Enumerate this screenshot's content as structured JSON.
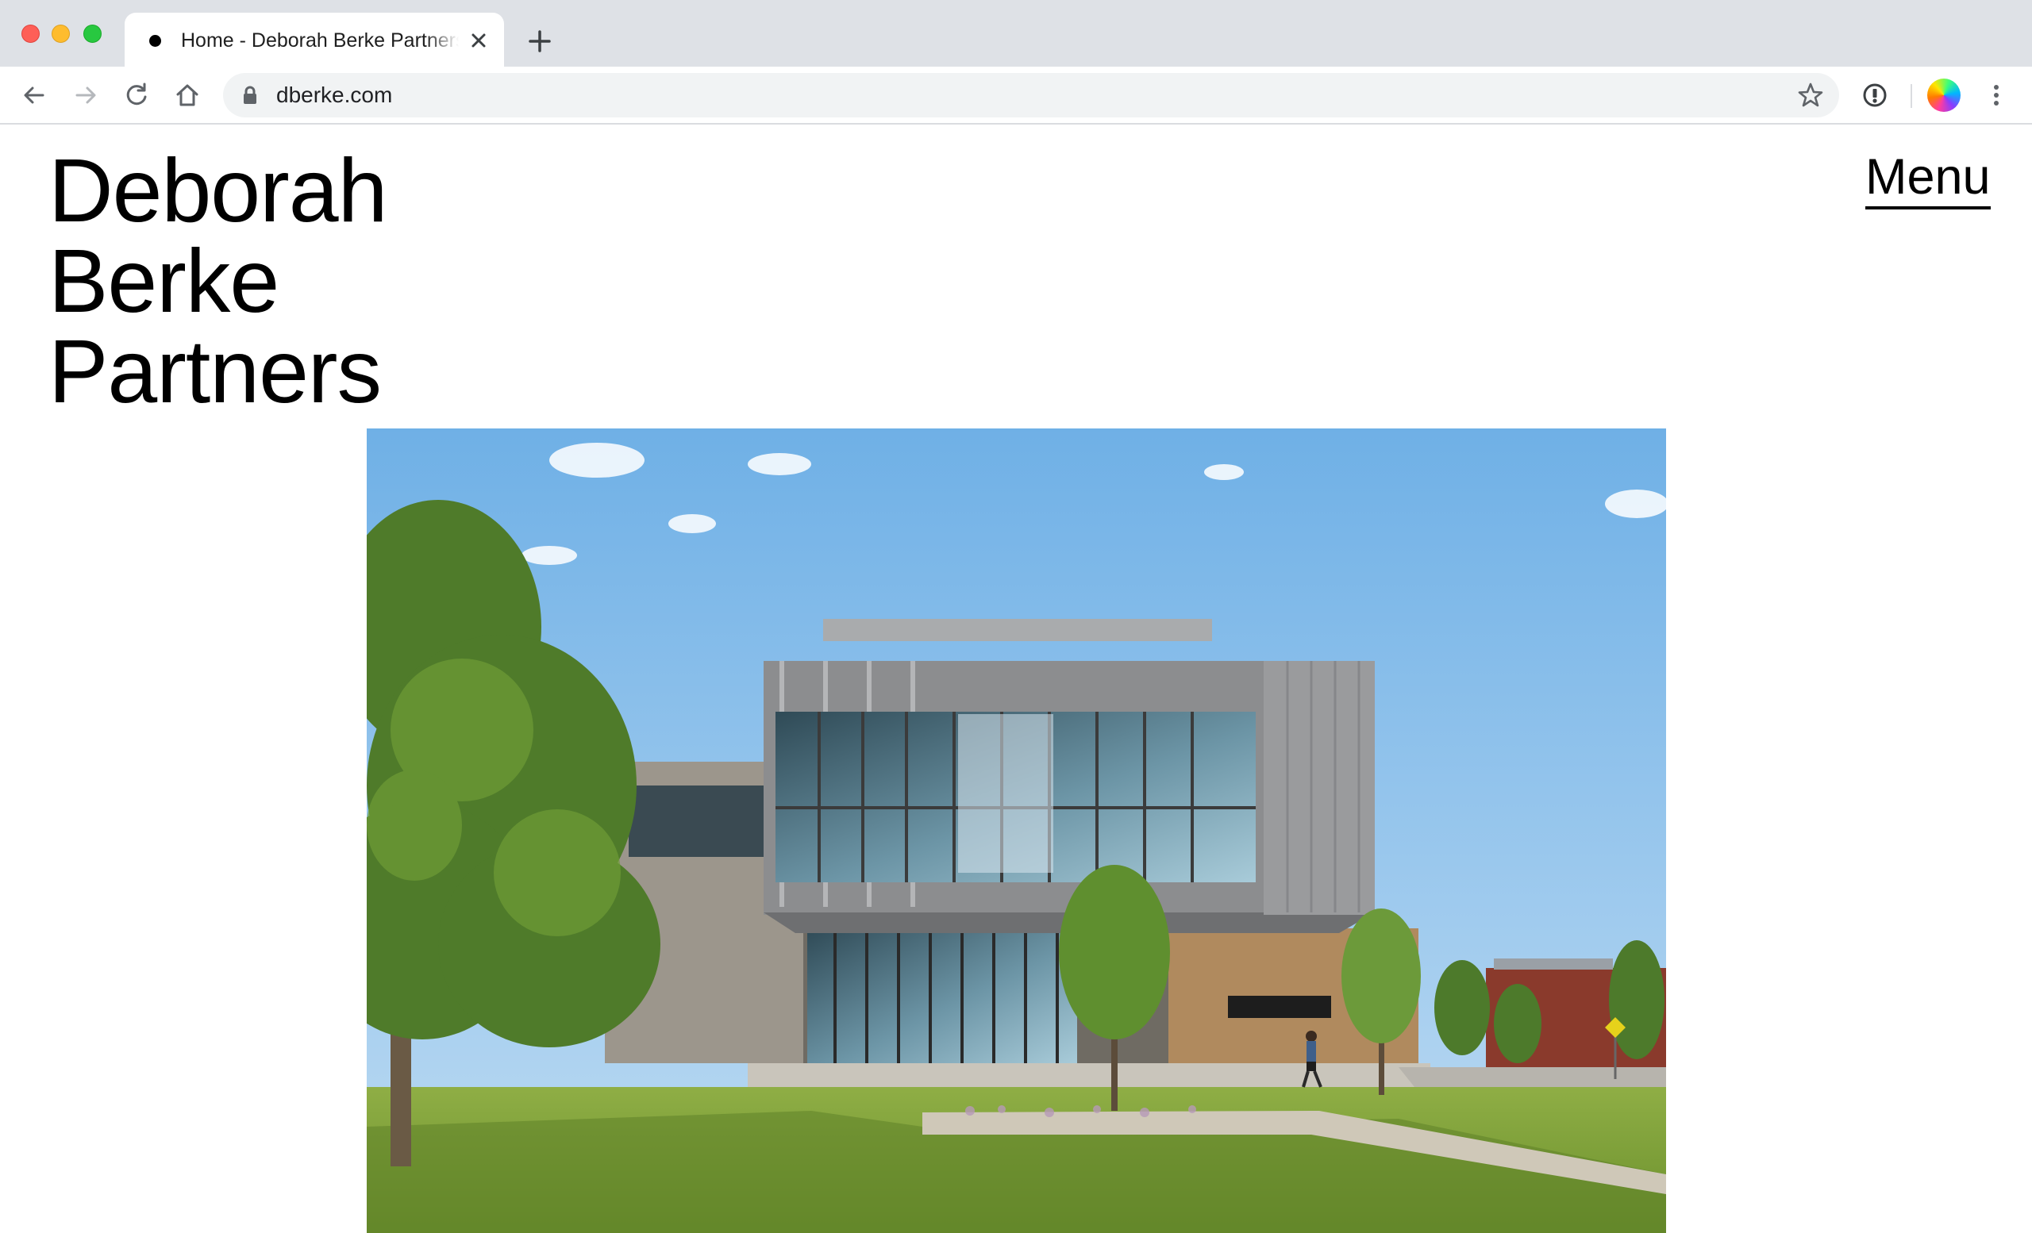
{
  "browser": {
    "tab_title": "Home - Deborah Berke Partners",
    "url": "dberke.com",
    "icons": [
      "close-icon",
      "plus-icon",
      "back-arrow-icon",
      "forward-arrow-icon",
      "reload-icon",
      "home-icon",
      "lock-icon",
      "star-icon",
      "extension-icon",
      "profile-avatar",
      "more-vert-icon"
    ]
  },
  "site": {
    "logo_lines": [
      "Deborah",
      "Berke",
      "Partners"
    ],
    "menu_label": "Menu"
  },
  "hero": {
    "alt": ""
  },
  "colors": {
    "chrome_bg": "#dee1e6",
    "omnibox_bg": "#f1f3f4",
    "text": "#000000",
    "sky": "#8fc4ee",
    "grass": "#7aa13a"
  }
}
